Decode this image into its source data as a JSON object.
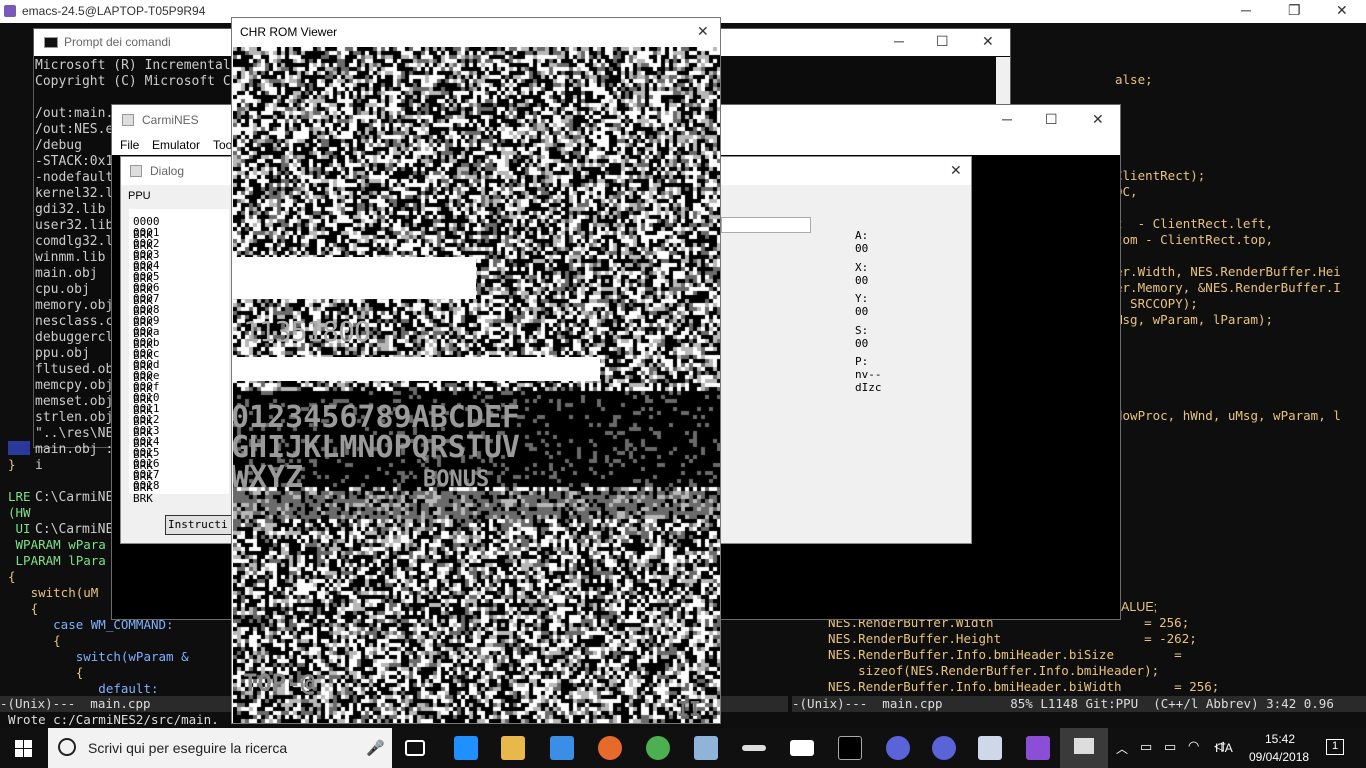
{
  "emacs": {
    "title": "emacs-24.5@LAPTOP-T05P9R94",
    "right_lines": [
      "alse;",
      "",
      "",
      "",
      "",
      "",
      "ClientRect);",
      "DC,",
      "",
      "t  - ClientRect.left,",
      "tom - ClientRect.top,",
      "",
      "er.Width, NES.RenderBuffer.Hei",
      "er.Memory, &NES.RenderBuffer.I",
      "  SRCCOPY);",
      "Msg, wParam, lParam);",
      "",
      "",
      "",
      "",
      "",
      "dowProc, hWnd, uMsg, wParam, l"
    ],
    "bottom_right_lines": [
      "NES.RenderBuffer.Width                    = 256;",
      "NES.RenderBuffer.Height                   = -262;",
      "NES.RenderBuffer.Info.bmiHeader.biSize        =",
      "    sizeof(NES.RenderBuffer.Info.bmiHeader);",
      "NES.RenderBuffer.Info.bmiHeader.biWidth       = 256;"
    ],
    "left_lines": [
      "}",
      "",
      "LRE",
      "(HW",
      " UI",
      " WPARAM wPara",
      " LPARAM lPara",
      "{",
      "   switch(uM",
      "   {",
      "      case WM_COMMAND:",
      "      {",
      "         switch(wParam &",
      "         {",
      "            default:"
    ],
    "value_line": "ALUE;",
    "modeline_left": "-(Unix)---  main.cpp",
    "modeline_right": "-(Unix)---  main.cpp         85% L1148 Git:PPU  (C++/l Abbrev) 3:42 0.96",
    "minibuffer": "Wrote c:/CarmiNES2/src/main."
  },
  "cmd": {
    "title": "Prompt dei comandi",
    "lines": [
      "Microsoft (R) Incremental",
      "Copyright (C) Microsoft C",
      "",
      "/out:main.",
      "/out:NES.e",
      "/debug",
      "-STACK:0x1",
      "-nodefault",
      "kernel32.l",
      "gdi32.lib",
      "user32.lib",
      "comdlg32.l",
      "winmm.lib",
      "main.obj",
      "cpu.obj",
      "memory.obj",
      "nesclass.c",
      "debuggercl",
      "ppu.obj",
      "fltused.ob",
      "memcpy.obj",
      "memset.obj",
      "strlen.obj",
      "\"..\\res\\NE",
      "main.obj :",
      "i",
      "",
      "C:\\CarmiNE",
      "",
      "C:\\CarmiNE"
    ]
  },
  "carmines": {
    "title": "CarmiNES",
    "menu": [
      "File",
      "Emulator",
      "Too"
    ]
  },
  "dialog": {
    "title": "Dialog",
    "group_label": "PPU",
    "instructions": [
      "0000 BRK",
      "0001 BRK",
      "0002 BRK",
      "0003 BRK",
      "0004 BRK",
      "0005 BRK",
      "0006 BRK",
      "0007 BRK",
      "0008 BRK",
      "0009 BRK",
      "000a BRK",
      "000b BRK",
      "000c BRK",
      "000d BRK",
      "000e BRK",
      "000f BRK",
      "0010 BRK",
      "0011 BRK",
      "0012 BRK",
      "0013 BRK",
      "0014 BRK",
      "0015 BRK",
      "0016 BRK",
      "0017 BRK",
      "0018 BRK"
    ],
    "button_label": "Instructi",
    "registers": [
      {
        "label": "A: 00"
      },
      {
        "label": "X: 00"
      },
      {
        "label": "Y: 00"
      },
      {
        "label": "S: 00"
      },
      {
        "label": "P: nv--dIzc"
      }
    ]
  },
  "chr_viewer": {
    "title": "CHR ROM Viewer",
    "score_text": "1135180O",
    "row_digits": "0123456789ABCDEF",
    "row_letters1": "GHIJKLMNOPQRSTUV",
    "row_letters2": "WXYZ",
    "bonus_text": "BONUS",
    "top_text": "TOP-@",
    "pause_text": "II"
  },
  "taskbar": {
    "search_placeholder": "Scrivi qui per eseguire la ricerca",
    "language": "ITA",
    "time": "15:42",
    "date": "09/04/2018",
    "notification_count": "1"
  },
  "colors": {
    "emacs_bg": "#0e0e0e",
    "code_yellow": "#e8c37a",
    "taskbar": "#101010",
    "accent_blue": "#1e90ff"
  }
}
